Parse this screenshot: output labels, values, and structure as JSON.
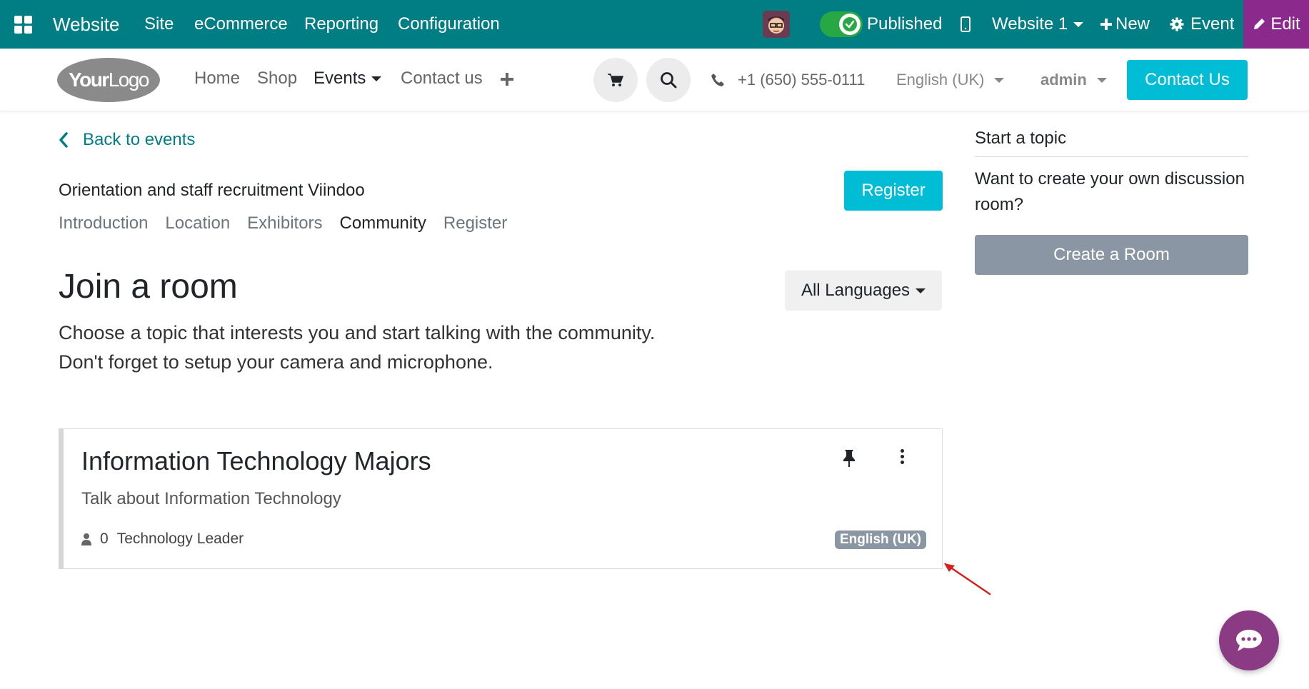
{
  "adminbar": {
    "app_name": "Website",
    "menus": [
      "Site",
      "eCommerce",
      "Reporting",
      "Configuration"
    ],
    "published_label": "Published",
    "website_selector": "Website 1",
    "new_label": "New",
    "event_label": "Event",
    "edit_label": "Edit",
    "colors": {
      "bar": "#017e84",
      "edit": "#8b2a8c",
      "toggle": "#28a745"
    }
  },
  "header": {
    "logo_text_bold": "Your",
    "logo_text": "Logo",
    "nav": [
      "Home",
      "Shop",
      "Events",
      "Contact us"
    ],
    "active_nav": "Events",
    "phone": "+1 (650) 555-0111",
    "language": "English (UK)",
    "user": "admin",
    "contact_button": "Contact Us",
    "icons": [
      "shopping-cart-icon",
      "search-icon",
      "phone-icon",
      "plus-icon"
    ]
  },
  "event": {
    "back_label": "Back to events",
    "title": "Orientation and staff recruitment Viindoo",
    "register_button": "Register",
    "tabs": [
      "Introduction",
      "Location",
      "Exhibitors",
      "Community",
      "Register"
    ],
    "active_tab": "Community"
  },
  "community": {
    "heading": "Join a room",
    "language_filter": "All Languages",
    "description_line1": "Choose a topic that interests you and start talking with the community.",
    "description_line2": "Don't forget to setup your camera and microphone."
  },
  "room": {
    "title": "Information Technology Majors",
    "subtitle": "Talk about Information Technology",
    "participants": "0",
    "target_audience": "Technology Leader",
    "language_badge": "English (UK)"
  },
  "sidebar": {
    "title": "Start a topic",
    "text": "Want to create your own discussion room?",
    "button": "Create a Room"
  }
}
